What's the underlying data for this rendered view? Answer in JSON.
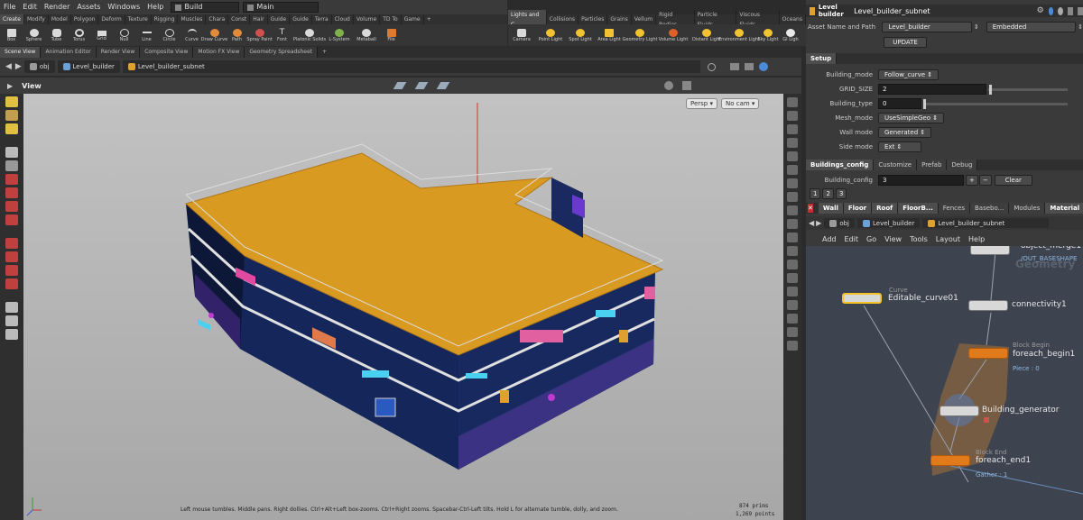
{
  "menu": {
    "items": [
      "File",
      "Edit",
      "Render",
      "Assets",
      "Windows",
      "Help"
    ],
    "desktop": "Build",
    "context": "Main"
  },
  "shelf_tabs": [
    "Create",
    "Modify",
    "Model",
    "Polygon",
    "Deform",
    "Texture",
    "Rigging",
    "Muscles",
    "Chara",
    "Const",
    "Hair",
    "Guide",
    "Guide",
    "Terra",
    "Cloud",
    "Volume",
    "TD To",
    "Game"
  ],
  "shelf_tools": [
    "Box",
    "Sphere",
    "Tube",
    "Torus",
    "Grid",
    "Null",
    "Line",
    "Circle",
    "Curve",
    "Draw Curve",
    "Path",
    "Spray Paint",
    "Font",
    "Platonic Solids",
    "L-System",
    "Metaball",
    "File"
  ],
  "shelf_tabs2": [
    "Lights and C",
    "Collisions",
    "Particles",
    "Grains",
    "Vellum",
    "Rigid Bodies",
    "Particle Fluids",
    "Viscous Fluids",
    "Oceans"
  ],
  "shelf_tools2": [
    "Camera",
    "Point Light",
    "Spot Light",
    "Area Light",
    "Geometry Light",
    "Volume Light",
    "Distant Light",
    "Environment Light",
    "Sky Light",
    "GI Ligh"
  ],
  "pane_tabs": [
    "Scene View",
    "Animation Editor",
    "Render View",
    "Composite View",
    "Motion FX View",
    "Geometry Spreadsheet"
  ],
  "path": {
    "root": "obj",
    "level1": "Level_builder",
    "level2": "Level_builder_subnet"
  },
  "viewport": {
    "title": "View",
    "persp": "Persp",
    "camera": "No cam",
    "status": "Left mouse tumbles. Middle pans. Right dollies. Ctrl+Alt+Left box-zooms. Ctrl+Right zooms. Spacebar-Ctrl-Left tilts. Hold L for alternate tumble, dolly, and zoom.",
    "prims": "874  prims",
    "points": "1,269 points"
  },
  "params": {
    "header_type": "Level builder",
    "header_name": "Level_builder_subnet",
    "asset_label": "Asset Name and Path",
    "asset_value": "Level_builder",
    "asset_mode": "Embedded",
    "update_btn": "UPDATE",
    "setup_tab": "Setup",
    "building_mode_label": "Building_mode",
    "building_mode": "Follow_curve",
    "grid_size_label": "GRID_SIZE",
    "grid_size": "2",
    "building_type_label": "Building_type",
    "building_type": "0",
    "mesh_mode_label": "Mesh_mode",
    "mesh_mode": "UseSimpleGeo",
    "wall_mode_label": "Wall mode",
    "wall_mode": "Generated",
    "side_mode_label": "Side mode",
    "side_mode": "Ext",
    "config_tabs": [
      "Buildings_config",
      "Customize",
      "Prefab",
      "Debug"
    ],
    "building_config_label": "Building_config",
    "building_config": "3",
    "clear_btn": "Clear",
    "pages": [
      "1",
      "2",
      "3"
    ],
    "part_tabs": [
      "Wall",
      "Floor",
      "Roof",
      "FloorB...",
      "Fences",
      "Basebo...",
      "Modules",
      "Material"
    ]
  },
  "network": {
    "path": {
      "root": "obj",
      "level1": "Level_builder",
      "level2": "Level_builder_subnet"
    },
    "menu": [
      "Add",
      "Edit",
      "Go",
      "View",
      "Tools",
      "Layout",
      "Help"
    ],
    "watermark": "Geometry",
    "nodes": {
      "merge": "object_merge1",
      "merge_sub": "/OUT_BASESHAPE",
      "curve_tag": "Curve",
      "curve": "Editable_curve01",
      "connectivity": "connectivity1",
      "begin_tag": "Block Begin",
      "begin": "foreach_begin1",
      "begin_sub": "Piece : 0",
      "generator": "Building_generator",
      "end_tag": "Block End",
      "end": "foreach_end1",
      "end_sub": "Gather : 1"
    }
  },
  "colors": {
    "roof": "#d99a22",
    "wall": "#12204a",
    "trim": "#e0e0e0",
    "accent": "#f5c22a",
    "net_bg": "#3d4450"
  }
}
